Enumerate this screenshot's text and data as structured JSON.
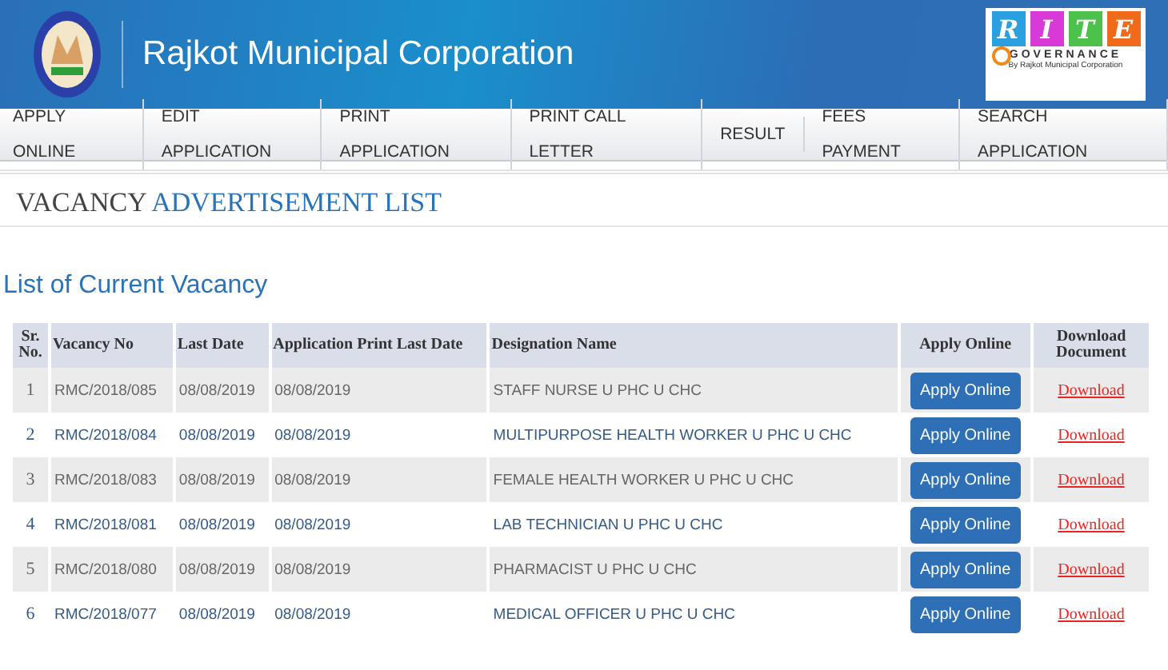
{
  "header": {
    "title": "Rajkot Municipal Corporation",
    "badge": {
      "letters": [
        "R",
        "I",
        "T",
        "E"
      ],
      "word": "GOVERNANCE",
      "byline": "By Rajkot Municipal Corporation"
    }
  },
  "nav": [
    "APPLY ONLINE",
    "EDIT APPLICATION",
    "PRINT APPLICATION",
    "PRINT CALL LETTER",
    "RESULT",
    "FEES PAYMENT",
    "SEARCH APPLICATION"
  ],
  "page_title": {
    "plain": "VACANCY",
    "accent": "ADVERTISEMENT LIST"
  },
  "section_title": "List of Current Vacancy",
  "table": {
    "columns": [
      "Sr. No.",
      "Vacancy No",
      "Last Date",
      "Application Print Last Date",
      "Designation Name",
      "Apply Online",
      "Download Document"
    ],
    "rows": [
      {
        "sr": "1",
        "vacancy": "RMC/2018/085",
        "last": "08/08/2019",
        "print_last": "08/08/2019",
        "designation": "STAFF NURSE U PHC U CHC",
        "action": "Apply Online",
        "link": "Download"
      },
      {
        "sr": "2",
        "vacancy": "RMC/2018/084",
        "last": "08/08/2019",
        "print_last": "08/08/2019",
        "designation": "MULTIPURPOSE HEALTH WORKER U PHC U CHC",
        "action": "Apply Online",
        "link": "Download"
      },
      {
        "sr": "3",
        "vacancy": "RMC/2018/083",
        "last": "08/08/2019",
        "print_last": "08/08/2019",
        "designation": "FEMALE HEALTH WORKER U PHC U CHC",
        "action": "Apply Online",
        "link": "Download"
      },
      {
        "sr": "4",
        "vacancy": "RMC/2018/081",
        "last": "08/08/2019",
        "print_last": "08/08/2019",
        "designation": "LAB TECHNICIAN U PHC U CHC",
        "action": "Apply Online",
        "link": "Download"
      },
      {
        "sr": "5",
        "vacancy": "RMC/2018/080",
        "last": "08/08/2019",
        "print_last": "08/08/2019",
        "designation": "PHARMACIST U PHC U CHC",
        "action": "Apply Online",
        "link": "Download"
      },
      {
        "sr": "6",
        "vacancy": "RMC/2018/077",
        "last": "08/08/2019",
        "print_last": "08/08/2019",
        "designation": "MEDICAL OFFICER U PHC U CHC",
        "action": "Apply Online",
        "link": "Download"
      }
    ]
  }
}
